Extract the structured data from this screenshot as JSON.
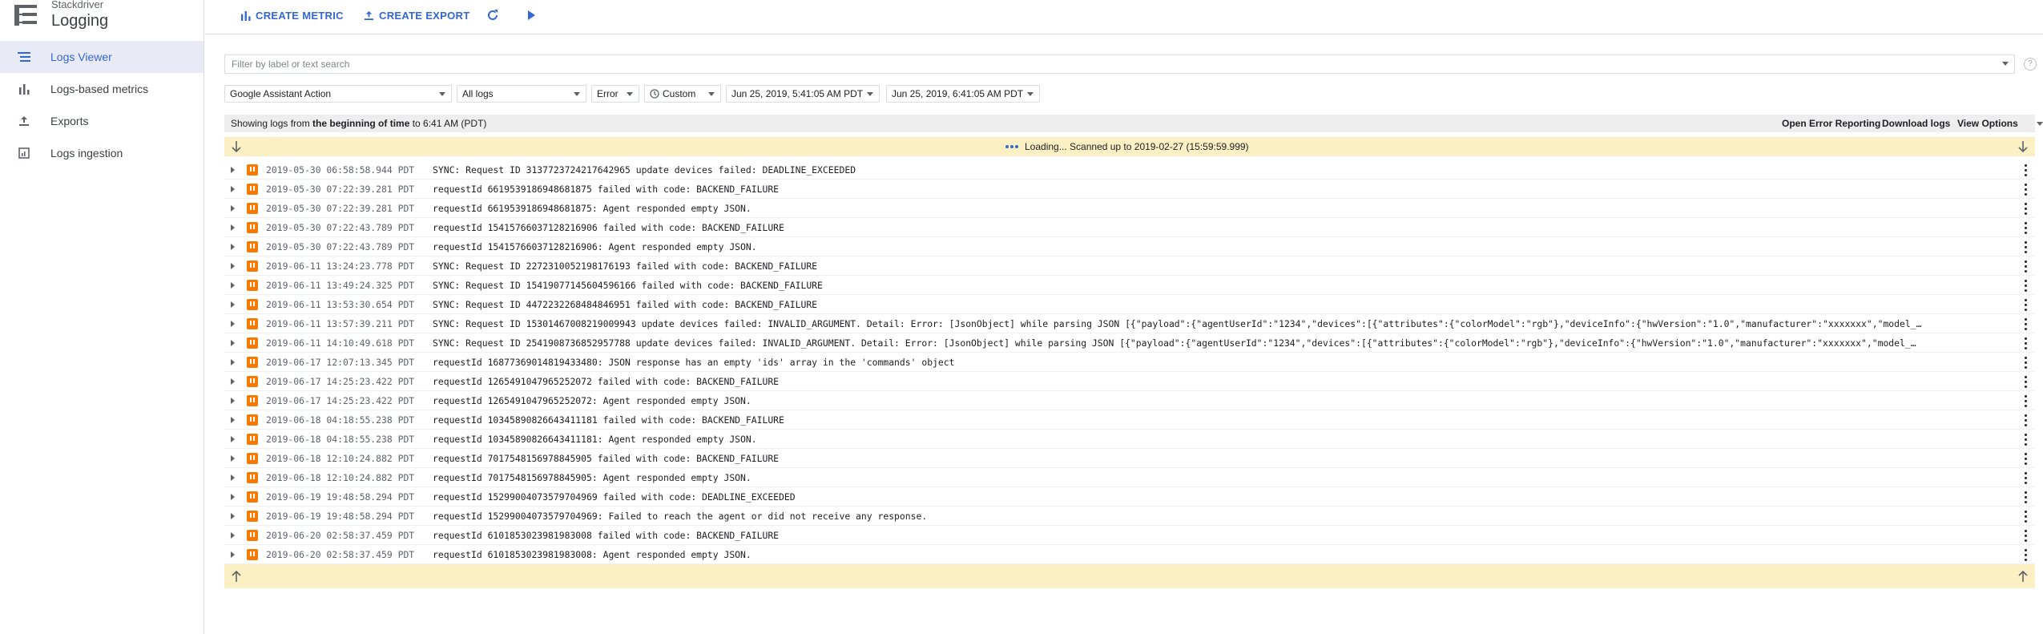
{
  "brand": {
    "subtitle": "Stackdriver",
    "title": "Logging"
  },
  "nav": [
    {
      "label": "Logs Viewer",
      "icon": "list-icon",
      "active": true
    },
    {
      "label": "Logs-based metrics",
      "icon": "bar-chart-icon",
      "active": false
    },
    {
      "label": "Exports",
      "icon": "export-icon",
      "active": false
    },
    {
      "label": "Logs ingestion",
      "icon": "ingestion-icon",
      "active": false
    }
  ],
  "toolbar": {
    "create_metric": "CREATE METRIC",
    "create_export": "CREATE EXPORT"
  },
  "search": {
    "placeholder": "Filter by label or text search"
  },
  "filters": {
    "resource": "Google Assistant Action",
    "logs": "All logs",
    "severity": "Error",
    "range": "Custom",
    "start": "Jun 25, 2019, 5:41:05 AM PDT",
    "end": "Jun 25, 2019, 6:41:05 AM PDT"
  },
  "info": {
    "prefix": "Showing logs from ",
    "bold": "the beginning of time",
    "mid": " to 6:41 AM (PDT)",
    "open_error": "Open Error Reporting",
    "download": "Download logs",
    "view_options": "View Options"
  },
  "loading": {
    "text": "Loading... Scanned up to 2019-02-27 (15:59:59.999)"
  },
  "colors": {
    "accent": "#3367d6",
    "error": "#f57c00",
    "banner": "#fbf0c4"
  },
  "logs": [
    {
      "ts": "2019-05-30 06:58:58.944 PDT",
      "msg": "SYNC: Request ID 3137723724217642965 update devices failed: DEADLINE_EXCEEDED"
    },
    {
      "ts": "2019-05-30 07:22:39.281 PDT",
      "msg": "requestId 6619539186948681875 failed with code: BACKEND_FAILURE"
    },
    {
      "ts": "2019-05-30 07:22:39.281 PDT",
      "msg": "requestId 6619539186948681875: Agent responded empty JSON."
    },
    {
      "ts": "2019-05-30 07:22:43.789 PDT",
      "msg": "requestId 15415766037128216906 failed with code: BACKEND_FAILURE"
    },
    {
      "ts": "2019-05-30 07:22:43.789 PDT",
      "msg": "requestId 15415766037128216906: Agent responded empty JSON."
    },
    {
      "ts": "2019-06-11 13:24:23.778 PDT",
      "msg": "SYNC: Request ID 2272310052198176193 failed with code: BACKEND_FAILURE"
    },
    {
      "ts": "2019-06-11 13:49:24.325 PDT",
      "msg": "SYNC: Request ID 15419077145604596166 failed with code: BACKEND_FAILURE"
    },
    {
      "ts": "2019-06-11 13:53:30.654 PDT",
      "msg": "SYNC: Request ID 4472232268484846951 failed with code: BACKEND_FAILURE"
    },
    {
      "ts": "2019-06-11 13:57:39.211 PDT",
      "msg": "SYNC: Request ID 15301467008219009943 update devices failed: INVALID_ARGUMENT. Detail: Error: [JsonObject] while parsing JSON [{\"payload\":{\"agentUserId\":\"1234\",\"devices\":[{\"attributes\":{\"colorModel\":\"rgb\"},\"deviceInfo\":{\"hwVersion\":\"1.0\",\"manufacturer\":\"xxxxxxx\",\"model_…"
    },
    {
      "ts": "2019-06-11 14:10:49.618 PDT",
      "msg": "SYNC: Request ID 2541908736852957788 update devices failed: INVALID_ARGUMENT. Detail: Error: [JsonObject] while parsing JSON [{\"payload\":{\"agentUserId\":\"1234\",\"devices\":[{\"attributes\":{\"colorModel\":\"rgb\"},\"deviceInfo\":{\"hwVersion\":\"1.0\",\"manufacturer\":\"xxxxxxx\",\"model_…"
    },
    {
      "ts": "2019-06-17 12:07:13.345 PDT",
      "msg": "requestId 16877369014819433480: JSON response has an empty 'ids' array in the 'commands' object"
    },
    {
      "ts": "2019-06-17 14:25:23.422 PDT",
      "msg": "requestId 1265491047965252072 failed with code: BACKEND_FAILURE"
    },
    {
      "ts": "2019-06-17 14:25:23.422 PDT",
      "msg": "requestId 1265491047965252072: Agent responded empty JSON."
    },
    {
      "ts": "2019-06-18 04:18:55.238 PDT",
      "msg": "requestId 10345890826643411181 failed with code: BACKEND_FAILURE"
    },
    {
      "ts": "2019-06-18 04:18:55.238 PDT",
      "msg": "requestId 10345890826643411181: Agent responded empty JSON."
    },
    {
      "ts": "2019-06-18 12:10:24.882 PDT",
      "msg": "requestId 7017548156978845905 failed with code: BACKEND_FAILURE"
    },
    {
      "ts": "2019-06-18 12:10:24.882 PDT",
      "msg": "requestId 7017548156978845905: Agent responded empty JSON."
    },
    {
      "ts": "2019-06-19 19:48:58.294 PDT",
      "msg": "requestId 1529900407357970496​9 failed with code: DEADLINE_EXCEEDED"
    },
    {
      "ts": "2019-06-19 19:48:58.294 PDT",
      "msg": "requestId 15299004073579704969: Failed to reach the agent or did not receive any response."
    },
    {
      "ts": "2019-06-20 02:58:37.459 PDT",
      "msg": "requestId 6101853023981983008 failed with code: BACKEND_FAILURE"
    },
    {
      "ts": "2019-06-20 02:58:37.459 PDT",
      "msg": "requestId 6101853023981983008: Agent responded empty JSON."
    }
  ]
}
